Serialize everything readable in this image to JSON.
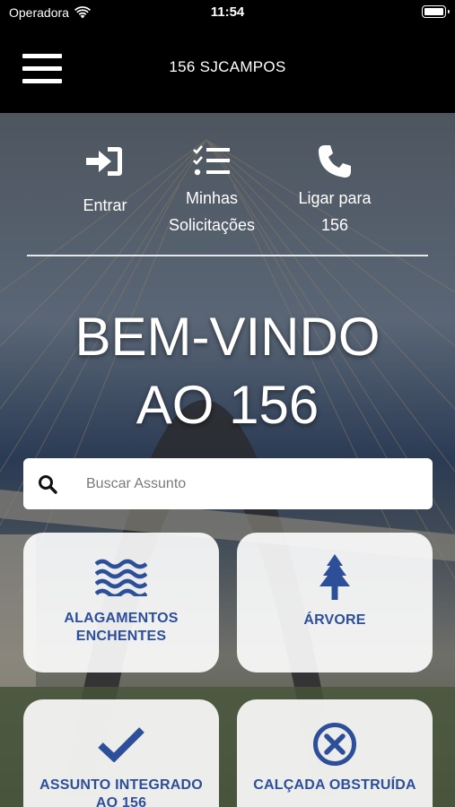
{
  "status_bar": {
    "carrier": "Operadora",
    "time": "11:54"
  },
  "nav": {
    "title": "156 SJCAMPOS",
    "menu_icon": "hamburger-icon"
  },
  "actions": [
    {
      "label": "Entrar",
      "icon": "sign-in-icon"
    },
    {
      "label_line1": "Minhas",
      "label_line2": "Solicitações",
      "icon": "checklist-icon"
    },
    {
      "label_line1": "Ligar para",
      "label_line2": "156",
      "icon": "phone-icon"
    }
  ],
  "welcome": {
    "line1": "BEM-VINDO",
    "line2": "AO 156"
  },
  "search": {
    "placeholder": "Buscar Assunto",
    "value": ""
  },
  "cards": [
    {
      "line1": "ALAGAMENTOS",
      "line2": "ENCHENTES",
      "icon": "waves-icon"
    },
    {
      "line1": "ÁRVORE",
      "line2": "",
      "icon": "tree-icon"
    },
    {
      "line1": "ASSUNTO INTEGRADO",
      "line2": "AO 156",
      "icon": "checkmark-icon"
    },
    {
      "line1": "CALÇADA OBSTRUÍDA",
      "line2": "",
      "icon": "x-circle-icon"
    }
  ],
  "colors": {
    "accent": "#2d4f9a",
    "bar": "#000000",
    "card_bg": "#ffffff"
  }
}
